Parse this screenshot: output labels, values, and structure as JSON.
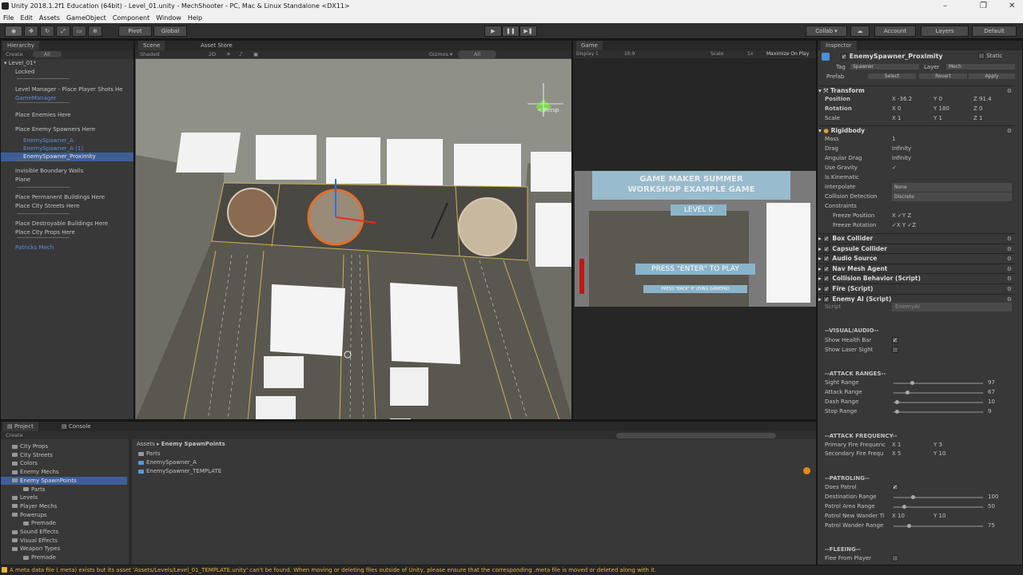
{
  "window": {
    "title": "Unity 2018.1.2f1 Education (64bit) - Level_01.unity - MechShooter - PC, Mac & Linux Standalone <DX11>"
  },
  "menu": [
    "File",
    "Edit",
    "Assets",
    "GameObject",
    "Component",
    "Window",
    "Help"
  ],
  "toolbar": {
    "pivot": "Pivot",
    "global": "Global",
    "collab": "Collab ▾",
    "account": "Account",
    "layers": "Layers",
    "layout": "Default"
  },
  "hierarchy": {
    "tab": "Hierarchy",
    "create": "Create",
    "search": "All",
    "scene": "Level_01*",
    "items": [
      {
        "label": "Locked",
        "style": "normal"
      },
      {
        "label": "Level Manager - Place Player Shots He",
        "style": "normal"
      },
      {
        "label": "GameManager",
        "style": "blue"
      },
      {
        "label": "Place Enemies Here",
        "style": "normal"
      },
      {
        "label": "Place Enemy Spawners Here",
        "style": "normal"
      },
      {
        "label": "EnemySpawner_A",
        "style": "blue"
      },
      {
        "label": "EnemySpawner_A (1)",
        "style": "blue"
      },
      {
        "label": "EnemySpawner_Proximity",
        "style": "selected"
      },
      {
        "label": "Invisible Boundary Walls",
        "style": "normal"
      },
      {
        "label": "Plane",
        "style": "normal"
      },
      {
        "label": "Place Permanent Buildings Here",
        "style": "normal"
      },
      {
        "label": "Place City Streets Here",
        "style": "normal"
      },
      {
        "label": "Place Destroyable Buildings Here",
        "style": "normal"
      },
      {
        "label": "Place City Props Here",
        "style": "normal"
      },
      {
        "label": "Patricks Mech",
        "style": "blue"
      }
    ]
  },
  "scene": {
    "tab": "Scene",
    "asset_store": "Asset Store",
    "shading": "Shaded",
    "mode2d": "2D",
    "gizmos": "Gizmos ▾",
    "search": "All",
    "persp": "< Persp"
  },
  "game": {
    "tab": "Game",
    "display": "Display 1",
    "aspect": "16:9",
    "scale_label": "Scale",
    "scale_value": "1x",
    "maximize": "Maximize On Play",
    "title_line1": "GAME MAKER SUMMER",
    "title_line2": "WORKSHOP EXAMPLE GAME",
    "level": "LEVEL 0",
    "press": "PRESS \"ENTER\" TO PLAY",
    "press_small": "PRESS \"BACK\" IF USING GAMEPAD"
  },
  "project": {
    "tab": "Project",
    "console_tab": "Console",
    "create": "Create",
    "tree": [
      {
        "label": "City Props",
        "indent": 1
      },
      {
        "label": "City Streets",
        "indent": 1
      },
      {
        "label": "Colors",
        "indent": 1
      },
      {
        "label": "Enemy Mechs",
        "indent": 1
      },
      {
        "label": "Enemy SpawnPoints",
        "indent": 1,
        "selected": true
      },
      {
        "label": "Parts",
        "indent": 2
      },
      {
        "label": "Levels",
        "indent": 1
      },
      {
        "label": "Player Mechs",
        "indent": 1
      },
      {
        "label": "Powerups",
        "indent": 1
      },
      {
        "label": "Premade",
        "indent": 2
      },
      {
        "label": "Sound Effects",
        "indent": 1
      },
      {
        "label": "Visual Effects",
        "indent": 1
      },
      {
        "label": "Weapon Types",
        "indent": 1
      },
      {
        "label": "Premade",
        "indent": 2
      }
    ],
    "breadcrumb_root": "Assets",
    "breadcrumb_current": "Enemy SpawnPoints",
    "files": [
      "Parts",
      "EnemySpawner_A",
      "EnemySpawner_TEMPLATE"
    ]
  },
  "inspector": {
    "tab": "Inspector",
    "object_name": "EnemySpawner_Proximity",
    "static": "Static",
    "tag_label": "Tag",
    "tag": "Spawner",
    "layer_label": "Layer",
    "layer": "Mech",
    "prefab": "Prefab",
    "select": "Select",
    "revert": "Revert",
    "apply": "Apply",
    "transform": {
      "title": "Transform",
      "position": {
        "label": "Position",
        "x": "-36.2",
        "y": "0",
        "z": "91.4"
      },
      "rotation": {
        "label": "Rotation",
        "x": "0",
        "y": "180",
        "z": "0"
      },
      "scale": {
        "label": "Scale",
        "x": "1",
        "y": "1",
        "z": "1"
      }
    },
    "rigidbody": {
      "title": "Rigidbody",
      "rows": [
        {
          "label": "Mass",
          "value": "1"
        },
        {
          "label": "Drag",
          "value": "Infinity"
        },
        {
          "label": "Angular Drag",
          "value": "Infinity"
        },
        {
          "label": "Use Gravity",
          "value": "✓"
        },
        {
          "label": "Is Kinematic",
          "value": ""
        },
        {
          "label": "Interpolate",
          "value": "None"
        },
        {
          "label": "Collision Detection",
          "value": "Discrete"
        },
        {
          "label": "Constraints",
          "value": ""
        },
        {
          "label": "Freeze Position",
          "value": "X ✓Y  Z"
        },
        {
          "label": "Freeze Rotation",
          "value": "✓X  Y ✓Z"
        }
      ]
    },
    "components": [
      "Box Collider",
      "Capsule Collider",
      "Audio Source",
      "Nav Mesh Agent",
      "Collision Behavior (Script)",
      "Fire (Script)",
      "Enemy AI (Script)"
    ],
    "script_label": "Script",
    "script_value": "EnemyAI",
    "visual_header": "--VISUAL/AUDIO--",
    "show_health": "Show Health Bar",
    "show_laser": "Show Laser Sight",
    "attack_ranges_header": "--ATTACK RANGES--",
    "ranges": [
      {
        "label": "Sight Range",
        "value": "97",
        "fraction": 0.19
      },
      {
        "label": "Attack Range",
        "value": "67",
        "fraction": 0.13
      },
      {
        "label": "Dash Range",
        "value": "10",
        "fraction": 0.02
      },
      {
        "label": "Stop Range",
        "value": "9",
        "fraction": 0.02
      }
    ],
    "attack_freq_header": "--ATTACK FREQUENCY--",
    "primary_fire": {
      "label": "Primary Fire Frequenc",
      "x": "1",
      "y": "3"
    },
    "secondary_fire": {
      "label": "Secondary Fire Frequ",
      "x": "5",
      "y": "10"
    },
    "patroling_header": "--PATROLING--",
    "does_patrol": "Does Patrol",
    "destination_range": {
      "label": "Destination Range",
      "value": "100",
      "fraction": 0.2
    },
    "patrol_area": {
      "label": "Patrol Area Range",
      "value": "50",
      "fraction": 0.1
    },
    "patrol_wander_time": {
      "label": "Patrol New Wander Ti",
      "x": "10",
      "y": "10"
    },
    "patrol_wander_range": {
      "label": "Patrol Wander Range",
      "value": "75",
      "fraction": 0.15
    },
    "fleeing_header": "--FLEEING--",
    "flee_player": "Flee From Player"
  },
  "status": "A meta data file (.meta) exists but its asset 'Assets/Levels/Level_01_TEMPLATE.unity' can't be found. When moving or deleting files outside of Unity, please ensure that the corresponding .meta file is moved or deleted along with it.",
  "colors": {
    "accent": "#3e5f96",
    "bg": "#383838",
    "status": "#e8b23a"
  }
}
